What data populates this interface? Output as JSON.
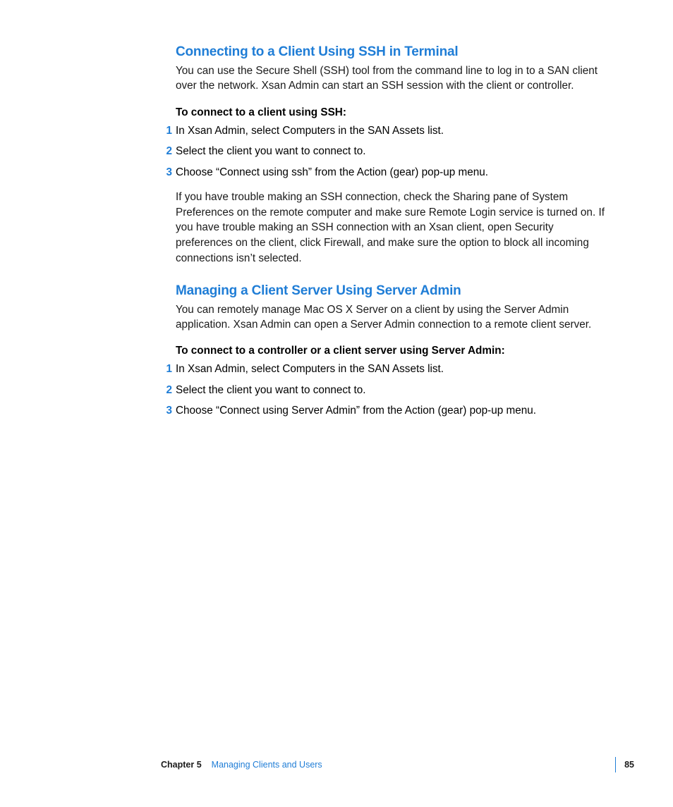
{
  "section1": {
    "heading": "Connecting to a Client Using SSH in Terminal",
    "intro": "You can use the Secure Shell (SSH) tool from the command line to log in to a SAN client over the network. Xsan Admin can start an SSH session with the client or controller.",
    "lead": "To connect to a client using SSH:",
    "steps": [
      {
        "num": "1",
        "text": "In Xsan Admin, select Computers in the SAN Assets list."
      },
      {
        "num": "2",
        "text": "Select the client you want to connect to."
      },
      {
        "num": "3",
        "text": "Choose “Connect using ssh” from the Action (gear) pop-up menu."
      }
    ],
    "after": "If you have trouble making an SSH connection, check the Sharing pane of System Preferences on the remote computer and make sure Remote Login service is turned on. If you have trouble making an SSH connection with an Xsan client, open Security preferences on the client, click Firewall, and make sure the option to block all incoming connections isn’t selected."
  },
  "section2": {
    "heading": "Managing a Client Server Using Server Admin",
    "intro": "You can remotely manage Mac OS X Server on a client by using the Server Admin application. Xsan Admin can open a Server Admin connection to a remote client server.",
    "lead": "To connect to a controller or a client server using Server Admin:",
    "steps": [
      {
        "num": "1",
        "text": "In Xsan Admin, select Computers in the SAN Assets list."
      },
      {
        "num": "2",
        "text": "Select the client you want to connect to."
      },
      {
        "num": "3",
        "text": "Choose “Connect using Server Admin” from the Action (gear) pop-up menu."
      }
    ]
  },
  "footer": {
    "chapter_label": "Chapter 5",
    "chapter_title": "Managing Clients and Users",
    "page_number": "85"
  }
}
